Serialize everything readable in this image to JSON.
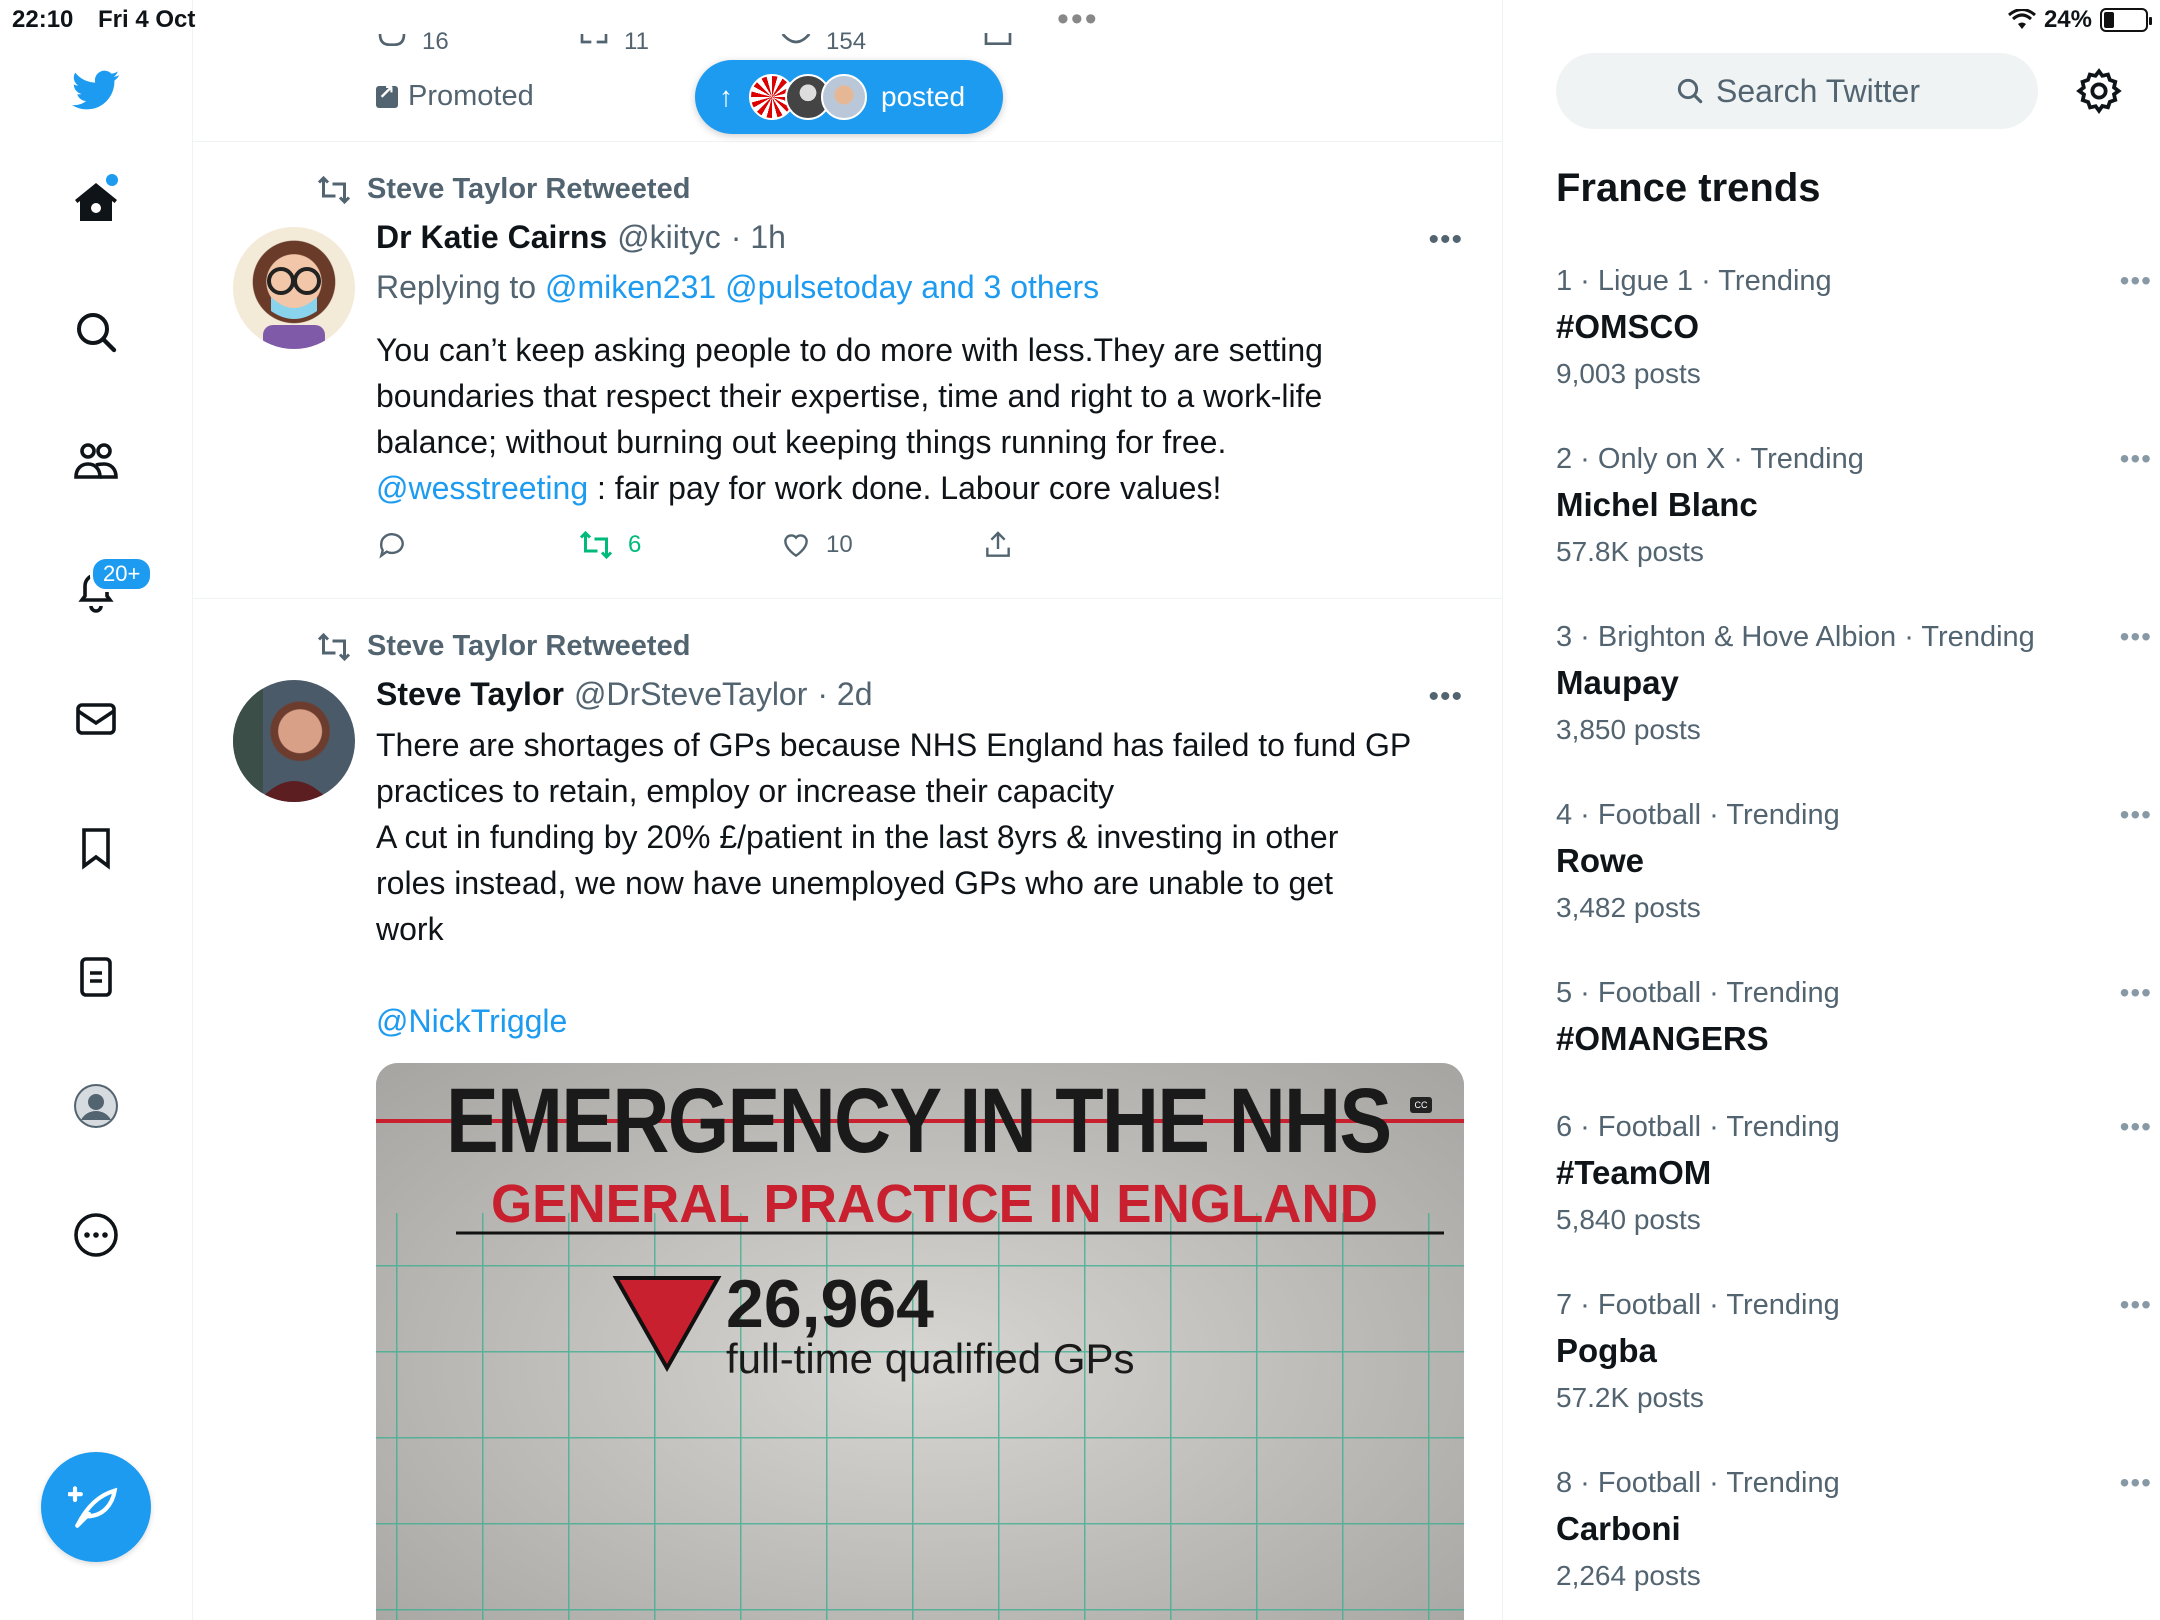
{
  "status_bar": {
    "time": "22:10",
    "date": "Fri 4 Oct",
    "battery": "24%",
    "battery_level": 0.24
  },
  "nav": {
    "notifications_badge": "20+"
  },
  "top_strip": {
    "reply_count": "16",
    "retweet_count": "11",
    "like_count": "154",
    "promoted_label": "Promoted",
    "posted_label": "posted"
  },
  "tweets": [
    {
      "retweeted_by": "Steve Taylor Retweeted",
      "name": "Dr Katie Cairns",
      "handle": "@kiityc",
      "time": "· 1h",
      "replying_prefix": "Replying to",
      "replying_to": "@miken231 @pulsetoday and 3 others",
      "text_lines": [
        "You can’t keep asking people to do more with less.They are setting",
        "boundaries that respect their expertise, time and right to a work-life",
        "balance; without burning out keeping things running for free."
      ],
      "mention": "@wesstreeting",
      "text_after_mention": " : fair pay for work done. Labour core values!",
      "retweets": "6",
      "likes": "10"
    },
    {
      "retweeted_by": "Steve Taylor Retweeted",
      "name": "Steve Taylor",
      "handle": "@DrSteveTaylor",
      "time": "· 2d",
      "text_lines": [
        "There are shortages of GPs because NHS England has failed to fund GP",
        "practices to retain, employ or increase their capacity",
        "A cut in funding by 20% £/patient in the last 8yrs & investing in other",
        "roles instead, we now have unemployed GPs who are unable to get",
        "work"
      ],
      "mention": "@NickTriggle",
      "media": {
        "headline": "EMERGENCY IN THE NHS",
        "subheadline": "GENERAL PRACTICE IN ENGLAND",
        "figure": "26,964",
        "figure_label": "full-time qualified GPs",
        "cc": "CC"
      }
    }
  ],
  "sidebar": {
    "search_placeholder": "Search Twitter",
    "trends_title": "France trends",
    "trends": [
      {
        "meta": "1 · Ligue 1 · Trending",
        "name": "#OMSCO",
        "count": "9,003 posts"
      },
      {
        "meta": "2 · Only on X · Trending",
        "name": "Michel Blanc",
        "count": "57.8K posts"
      },
      {
        "meta": "3 · Brighton & Hove Albion · Trending",
        "name": "Maupay",
        "count": "3,850 posts"
      },
      {
        "meta": "4 · Football · Trending",
        "name": "Rowe",
        "count": "3,482 posts"
      },
      {
        "meta": "5 · Football · Trending",
        "name": "#OMANGERS",
        "count": ""
      },
      {
        "meta": "6 · Football · Trending",
        "name": "#TeamOM",
        "count": "5,840 posts"
      },
      {
        "meta": "7 · Football · Trending",
        "name": "Pogba",
        "count": "57.2K posts"
      },
      {
        "meta": "8 · Football · Trending",
        "name": "Carboni",
        "count": "2,264 posts"
      }
    ]
  },
  "colors": {
    "accent": "#1d9bf0",
    "retweet_green": "#00ba7c",
    "secondary_text": "#536471",
    "headline_red": "#c8202f"
  }
}
